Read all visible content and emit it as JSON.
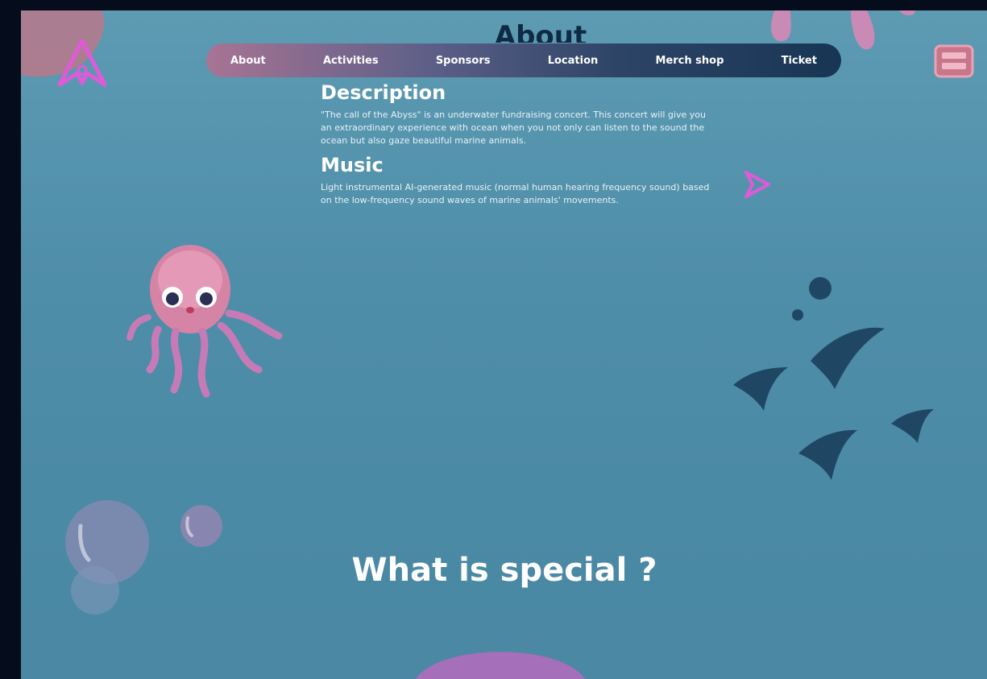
{
  "page": {
    "heading": "About"
  },
  "nav": {
    "items": [
      {
        "label": "About"
      },
      {
        "label": "Activities"
      },
      {
        "label": "Sponsors"
      },
      {
        "label": "Location"
      },
      {
        "label": "Merch shop"
      },
      {
        "label": "Ticket"
      }
    ]
  },
  "description": {
    "title": "Description",
    "text": "\"The call of the Abyss\" is an underwater fundraising concert. This concert will give you an extraordinary experience with ocean when you not only can listen to the sound the ocean but also gaze beautiful marine animals."
  },
  "music": {
    "title": "Music",
    "text": "Light instrumental AI-generated music (normal human hearing frequency sound) based on the low-frequency sound waves of marine animals' movements."
  },
  "special": {
    "title": "What is special ?"
  },
  "icons": {
    "logo": "triangle-logo-icon",
    "ticket": "ticket-icon",
    "play": "play-icon",
    "jellyfish": "jellyfish-illustration",
    "fish": "fish-school-illustration",
    "bubbles": "bubbles-illustration"
  },
  "colors": {
    "background": "#4f8ea9",
    "accent": "#e05ad8",
    "nav_start": "#a87494",
    "nav_end": "#183554",
    "fish": "#1f4763"
  }
}
